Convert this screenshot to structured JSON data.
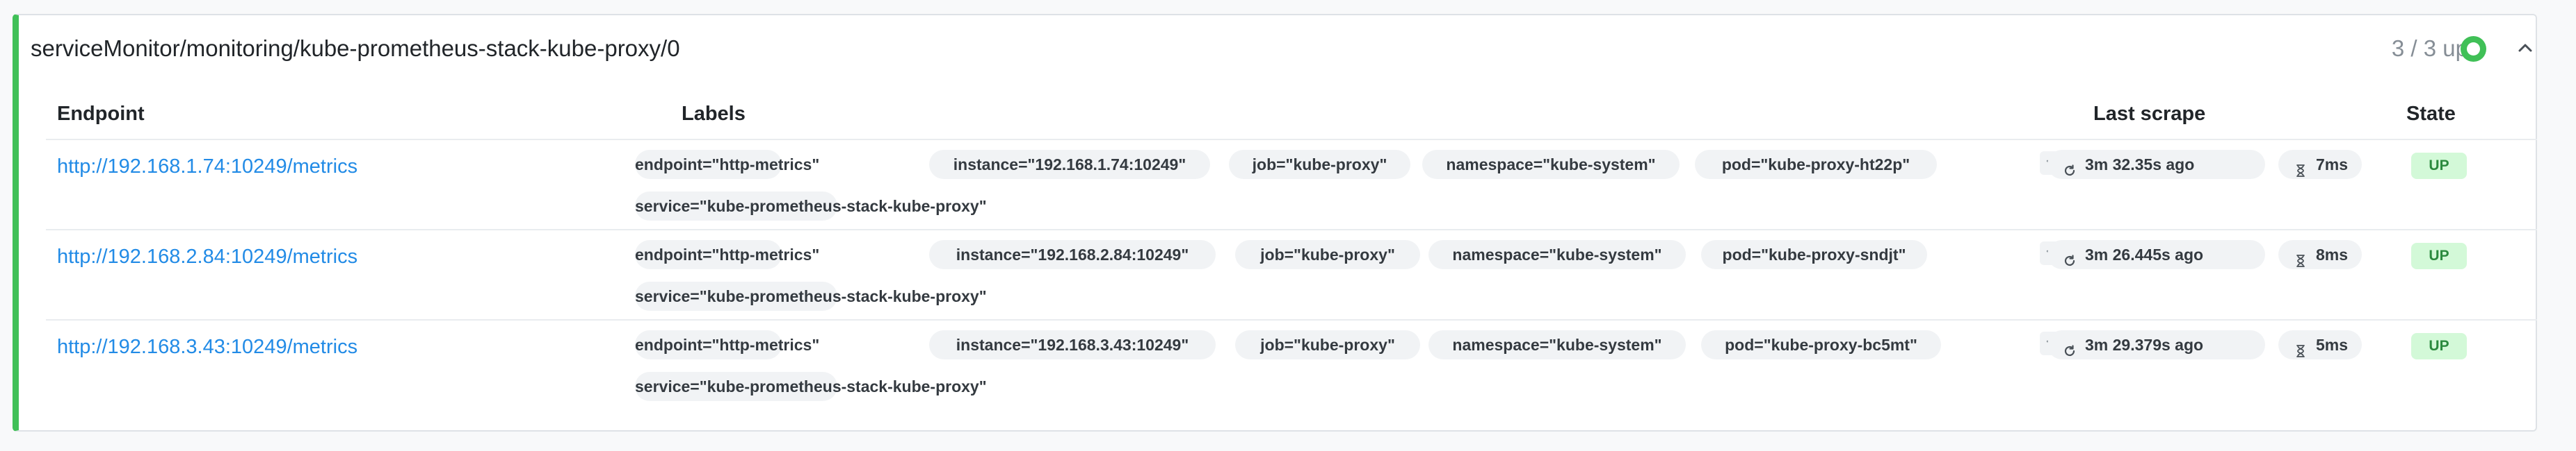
{
  "pool": {
    "title": "serviceMonitor/monitoring/kube-prometheus-stack-kube-proxy/0",
    "status_text": "3 / 3 up",
    "status_color": "#40c057",
    "collapse_icon": "chevron-up-icon"
  },
  "table": {
    "headers": {
      "endpoint": "Endpoint",
      "labels": "Labels",
      "last_scrape": "Last scrape",
      "state": "State"
    },
    "rows": [
      {
        "endpoint": "http://192.168.1.74:10249/metrics",
        "labels": [
          "endpoint=\"http-metrics\"",
          "instance=\"192.168.1.74:10249\"",
          "job=\"kube-proxy\"",
          "namespace=\"kube-system\"",
          "pod=\"kube-proxy-ht22p\"",
          "service=\"kube-prometheus-stack-kube-proxy\""
        ],
        "last_scrape": "3m 32.35s ago",
        "duration": "7ms",
        "state": "UP"
      },
      {
        "endpoint": "http://192.168.2.84:10249/metrics",
        "labels": [
          "endpoint=\"http-metrics\"",
          "instance=\"192.168.2.84:10249\"",
          "job=\"kube-proxy\"",
          "namespace=\"kube-system\"",
          "pod=\"kube-proxy-sndjt\"",
          "service=\"kube-prometheus-stack-kube-proxy\""
        ],
        "last_scrape": "3m 26.445s ago",
        "duration": "8ms",
        "state": "UP"
      },
      {
        "endpoint": "http://192.168.3.43:10249/metrics",
        "labels": [
          "endpoint=\"http-metrics\"",
          "instance=\"192.168.3.43:10249\"",
          "job=\"kube-proxy\"",
          "namespace=\"kube-system\"",
          "pod=\"kube-proxy-bc5mt\"",
          "service=\"kube-prometheus-stack-kube-proxy\""
        ],
        "last_scrape": "3m 29.379s ago",
        "duration": "5ms",
        "state": "UP"
      }
    ]
  },
  "icons": {
    "expand": "chevron-down-icon",
    "scrape": "refresh-icon",
    "duration": "hourglass-icon"
  },
  "colors": {
    "link": "#228be6",
    "up_badge_bg": "#d3f9d8",
    "up_badge_text": "#2b8a3e",
    "accent_bar": "#40c057"
  }
}
